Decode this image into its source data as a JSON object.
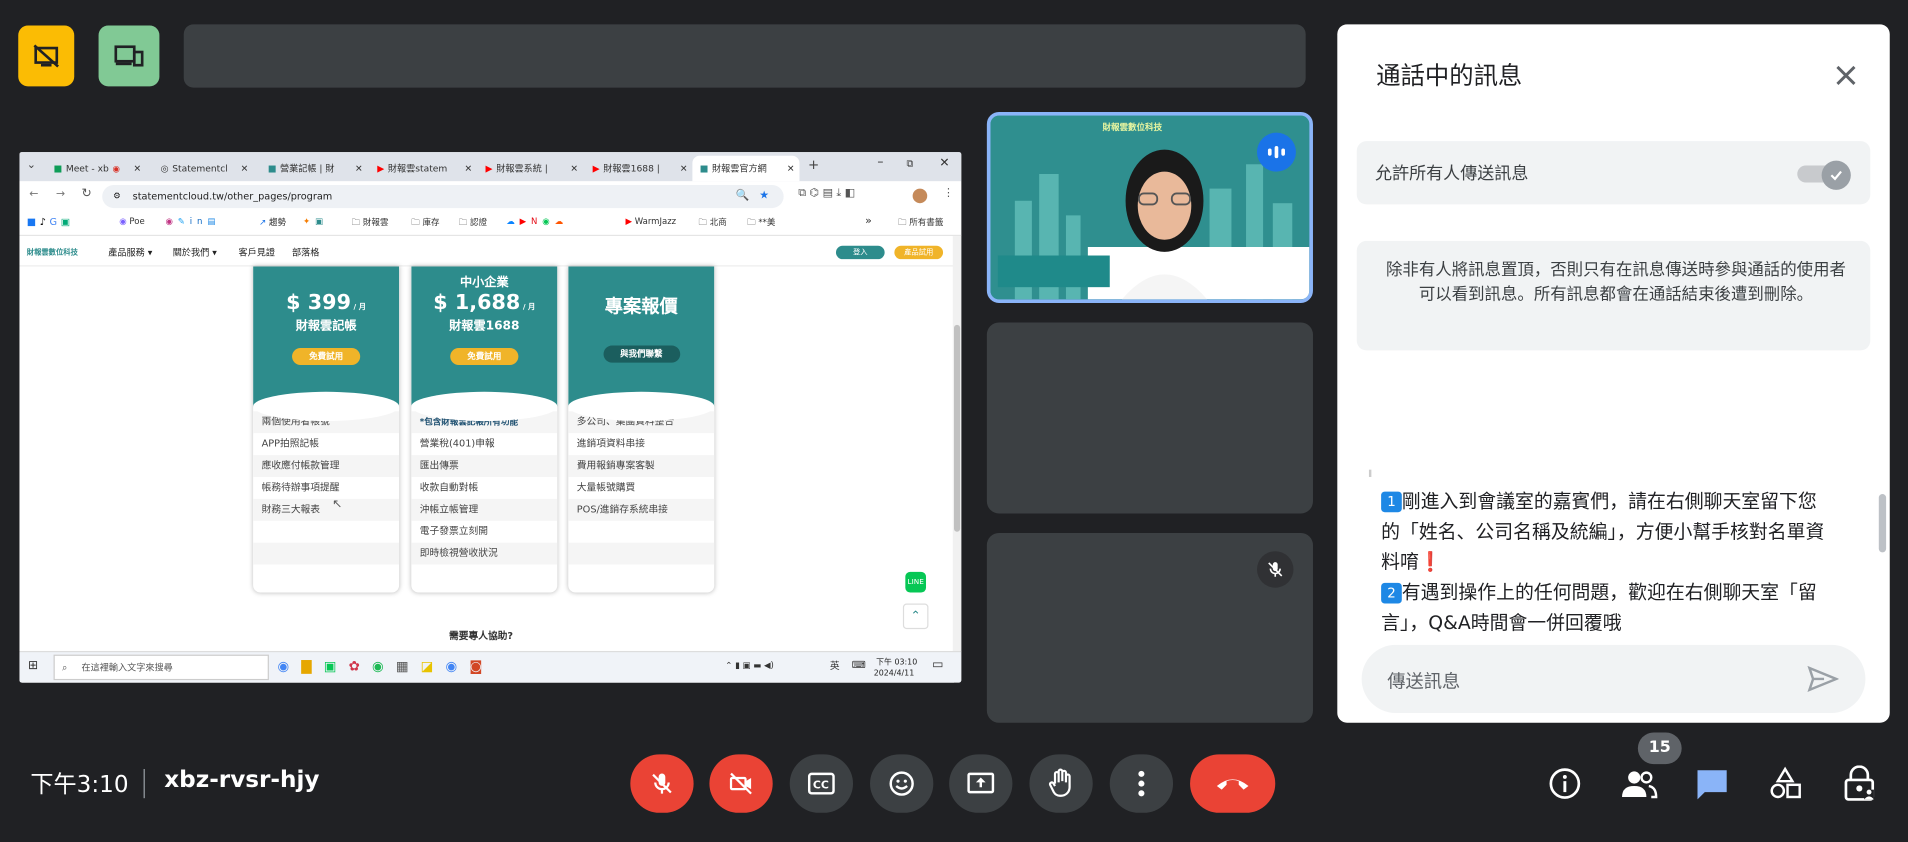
{
  "meeting": {
    "time": "下午3:10",
    "code": "xbz-rvsr-hjy",
    "people_count": "15"
  },
  "browser": {
    "tabs": [
      {
        "label": "Meet - xb"
      },
      {
        "label": "Statementcl"
      },
      {
        "label": "營業記帳 | 財"
      },
      {
        "label": "財報雲statem"
      },
      {
        "label": "財報雲系統 |"
      },
      {
        "label": "財報雲1688 |"
      },
      {
        "label": "財報雲官方網"
      }
    ],
    "url": "statementcloud.tw/other_pages/program",
    "bookmarks": [
      "Poe",
      "趨勢",
      "財報雲",
      "庫存",
      "認證",
      "WarmJazz",
      "北商",
      "**美",
      "所有書籤"
    ]
  },
  "site": {
    "logo_text": "財報雲數位科技",
    "nav": [
      "產品服務 ▾",
      "關於我們 ▾",
      "客戶見證",
      "部落格"
    ],
    "login": "登入",
    "trial": "產品試用",
    "cards": [
      {
        "top_label": "",
        "price": "$ 399",
        "unit": "/ 月",
        "plan": "財報雲記帳",
        "button": "免費試用",
        "features": [
          "兩個使用者帳號",
          "APP拍照記帳",
          "應收應付帳款管理",
          "帳務待辦事項提醒",
          "財務三大報表",
          "",
          "",
          ""
        ]
      },
      {
        "top_label": "中小企業",
        "price": "$ 1,688",
        "unit": "/ 月",
        "plan": "財報雲1688",
        "button": "免費試用",
        "features": [
          "*包含財報雲記帳所有功能",
          "營業稅(401)申報",
          "匯出傳票",
          "收款自動對帳",
          "沖帳立帳管理",
          "電子發票立刻開",
          "即時檢視營收狀況",
          ""
        ]
      },
      {
        "top_label": "",
        "price": "",
        "unit": "",
        "plan": "專案報價",
        "button": "與我們聯繫",
        "features": [
          "多公司、集團資料整合",
          "進銷項資料串接",
          "費用報銷專案客製",
          "大量帳號購買",
          "POS/進銷存系統串接",
          "",
          "",
          ""
        ]
      }
    ],
    "help_text": "需要專人協助?"
  },
  "taskbar": {
    "search_placeholder": "在這裡輸入文字來搜尋",
    "ime": "英",
    "clock_time": "下午 03:10",
    "clock_date": "2024/4/11"
  },
  "chat": {
    "title": "通話中的訊息",
    "allow_label": "允許所有人傳送訊息",
    "allow_enabled": true,
    "notice": "除非有人將訊息置頂，否則只有在訊息傳送時參與通話的使用者可以看到訊息。所有訊息都會在通話結束後遭到刪除。",
    "message_1_num": "1",
    "message_1": "剛進入到會議室的嘉賓們，請在右側聊天室留下您的「姓名、公司名稱及統編」，方便小幫手核對名單資料唷",
    "message_1_mark": "❗",
    "message_2_num": "2",
    "message_2": "有遇到操作上的任何問題，歡迎在右側聊天室「留言」，Q&A時間會一併回覆哦",
    "input_placeholder": "傳送訊息"
  },
  "presenter": {
    "banner": "財報雲數位科技"
  },
  "colors": {
    "background": "#202124",
    "tile": "#3c4043",
    "red": "#ea4335",
    "active_blue": "#8ab4f8",
    "teal": "#2d8c8c",
    "badge_yellow": "#fbbc04",
    "badge_green": "#81c995"
  },
  "icons": {
    "top_left_1": "no-presentation-icon",
    "top_left_2": "devices-icon"
  }
}
